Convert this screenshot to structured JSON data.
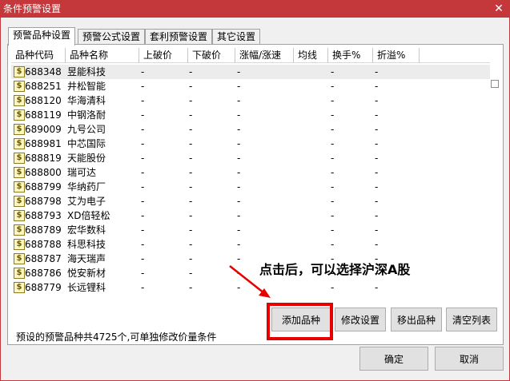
{
  "window": {
    "title": "条件预警设置",
    "close_glyph": "✕"
  },
  "tabs": [
    {
      "label": "预警品种设置",
      "active": true
    },
    {
      "label": "预警公式设置",
      "active": false
    },
    {
      "label": "套利预警设置",
      "active": false
    },
    {
      "label": "其它设置",
      "active": false
    }
  ],
  "table": {
    "columns": [
      "品种代码",
      "品种名称",
      "上破价",
      "下破价",
      "涨幅/涨速",
      "均线",
      "换手%",
      "折溢%"
    ],
    "rows": [
      {
        "code": "688348",
        "name": "昱能科技",
        "up": "-",
        "down": "-",
        "chg": "-",
        "ma": "",
        "turn": "-",
        "prem": "-"
      },
      {
        "code": "688251",
        "name": "井松智能",
        "up": "-",
        "down": "-",
        "chg": "-",
        "ma": "",
        "turn": "-",
        "prem": "-"
      },
      {
        "code": "688120",
        "name": "华海清科",
        "up": "-",
        "down": "-",
        "chg": "-",
        "ma": "",
        "turn": "-",
        "prem": "-"
      },
      {
        "code": "688119",
        "name": "中钢洛耐",
        "up": "-",
        "down": "-",
        "chg": "-",
        "ma": "",
        "turn": "-",
        "prem": "-"
      },
      {
        "code": "689009",
        "name": "九号公司",
        "up": "-",
        "down": "-",
        "chg": "-",
        "ma": "",
        "turn": "-",
        "prem": "-"
      },
      {
        "code": "688981",
        "name": "中芯国际",
        "up": "-",
        "down": "-",
        "chg": "-",
        "ma": "",
        "turn": "-",
        "prem": "-"
      },
      {
        "code": "688819",
        "name": "天能股份",
        "up": "-",
        "down": "-",
        "chg": "-",
        "ma": "",
        "turn": "-",
        "prem": "-"
      },
      {
        "code": "688800",
        "name": "瑞可达",
        "up": "-",
        "down": "-",
        "chg": "-",
        "ma": "",
        "turn": "-",
        "prem": "-"
      },
      {
        "code": "688799",
        "name": "华纳药厂",
        "up": "-",
        "down": "-",
        "chg": "-",
        "ma": "",
        "turn": "-",
        "prem": "-"
      },
      {
        "code": "688798",
        "name": "艾为电子",
        "up": "-",
        "down": "-",
        "chg": "-",
        "ma": "",
        "turn": "-",
        "prem": "-"
      },
      {
        "code": "688793",
        "name": "XD倍轻松",
        "up": "-",
        "down": "-",
        "chg": "-",
        "ma": "",
        "turn": "-",
        "prem": "-"
      },
      {
        "code": "688789",
        "name": "宏华数科",
        "up": "-",
        "down": "-",
        "chg": "-",
        "ma": "",
        "turn": "-",
        "prem": "-"
      },
      {
        "code": "688788",
        "name": "科思科技",
        "up": "-",
        "down": "-",
        "chg": "-",
        "ma": "",
        "turn": "-",
        "prem": "-"
      },
      {
        "code": "688787",
        "name": "海天瑞声",
        "up": "-",
        "down": "-",
        "chg": "-",
        "ma": "",
        "turn": "-",
        "prem": "-"
      },
      {
        "code": "688786",
        "name": "悦安新材",
        "up": "-",
        "down": "-",
        "chg": "-",
        "ma": "",
        "turn": "-",
        "prem": "-"
      },
      {
        "code": "688779",
        "name": "长远锂科",
        "up": "-",
        "down": "-",
        "chg": "-",
        "ma": "",
        "turn": "-",
        "prem": "-"
      }
    ],
    "row_icon": "dollar-icon",
    "row_icon_glyph": "$"
  },
  "summary": "预设的预警品种共4725个,可单独修改价量条件",
  "buttons": {
    "add": "添加品种",
    "modify": "修改设置",
    "remove": "移出品种",
    "clear": "清空列表",
    "ok": "确定",
    "cancel": "取消"
  },
  "annotation": {
    "text": "点击后，可以选择沪深A股",
    "color": "#e80000"
  },
  "colors": {
    "titlebar": "#c4373a",
    "highlight": "#e80000"
  }
}
